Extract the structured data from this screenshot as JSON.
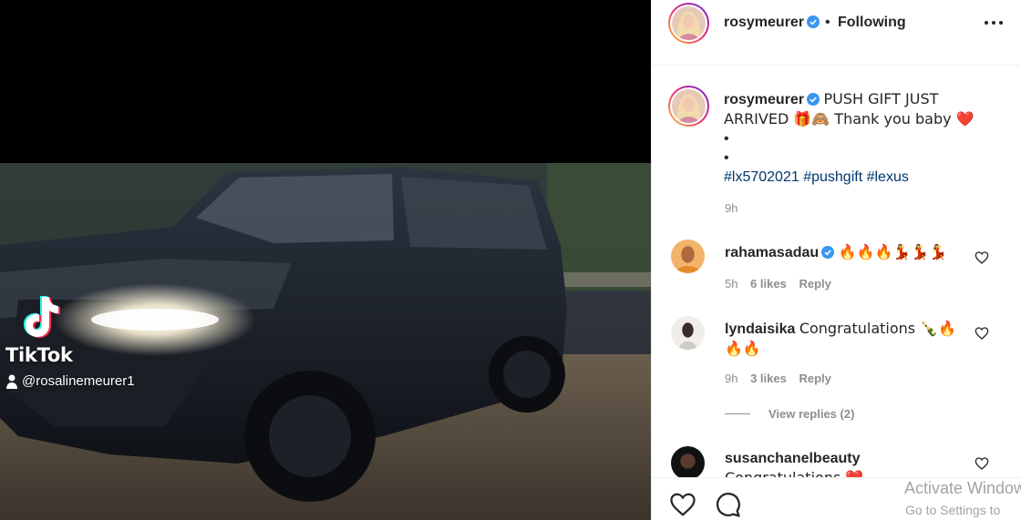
{
  "post": {
    "overlay": {
      "brand": "TikTok",
      "handle": "@rosalinemeurer1"
    },
    "author": "rosymeurer",
    "follow_state": "Following",
    "separator": "•",
    "caption": {
      "text": "PUSH GIFT JUST ARRIVED 🎁🙈 Thank you baby ❤️",
      "bullets": [
        "•",
        "•"
      ],
      "hashtags": [
        "#lx5702021",
        "#pushgift",
        "#lexus"
      ],
      "time": "9h"
    },
    "comments": [
      {
        "user": "rahamasadau",
        "verified": true,
        "text": "🔥🔥🔥💃💃💃",
        "time": "5h",
        "likes": "6 likes",
        "reply": "Reply"
      },
      {
        "user": "lyndaisika",
        "verified": false,
        "text": "Congratulations 🍾🔥🔥🔥",
        "time": "9h",
        "likes": "3 likes",
        "reply": "Reply",
        "view_replies": "View replies (2)"
      },
      {
        "user": "susanchanelbeauty",
        "verified": false,
        "text": "Congratulations ❤️"
      }
    ]
  },
  "icons": [
    "verified-badge-icon",
    "more-options-icon",
    "heart-icon",
    "comment-icon",
    "tiktok-logo-icon",
    "person-icon"
  ],
  "colors": {
    "verified": "#3897f0",
    "hashtag": "#00376b",
    "muted": "#8e8e8e",
    "heart_red": "#ed4956"
  },
  "windows": {
    "activate": "Activate Windows",
    "settings": "Go to Settings to"
  }
}
